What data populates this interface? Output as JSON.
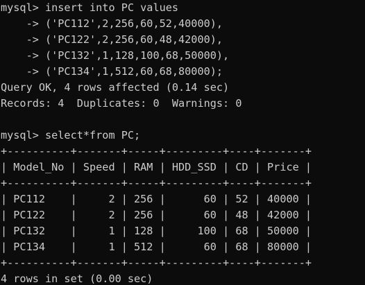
{
  "terminal": {
    "lines": [
      "mysql> insert into PC values",
      "    -> ('PC112',2,256,60,52,40000),",
      "    -> ('PC122',2,256,60,48,42000),",
      "    -> ('PC132',1,128,100,68,50000),",
      "    -> ('PC134',1,512,60,68,80000);",
      "Query OK, 4 rows affected (0.14 sec)",
      "Records: 4  Duplicates: 0  Warnings: 0",
      "",
      "mysql> select*from PC;",
      "+----------+-------+-----+---------+----+-------+",
      "| Model_No | Speed | RAM | HDD_SSD | CD | Price |",
      "+----------+-------+-----+---------+----+-------+",
      "| PC112    |     2 | 256 |      60 | 52 | 40000 |",
      "| PC122    |     2 | 256 |      60 | 48 | 42000 |",
      "| PC132    |     1 | 128 |     100 | 68 | 50000 |",
      "| PC134    |     1 | 512 |      60 | 68 | 80000 |",
      "+----------+-------+-----+---------+----+-------+",
      "4 rows in set (0.00 sec)"
    ]
  }
}
